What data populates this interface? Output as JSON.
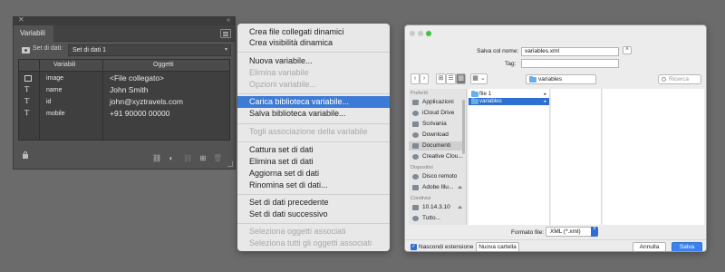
{
  "panel": {
    "close_glyph": "✕",
    "collapse_glyph": "«",
    "tab": "Variabili",
    "dataset_label": "Set di dati:",
    "dataset_value": "Set di dati 1",
    "columns": [
      "Variabili",
      "Oggetti"
    ],
    "rows": [
      {
        "icon": "image-icon",
        "type_glyph": "",
        "name": "image",
        "value": "<File collegato>"
      },
      {
        "icon": "text-icon",
        "type_glyph": "T",
        "name": "name",
        "value": "John Smith"
      },
      {
        "icon": "text-icon",
        "type_glyph": "T",
        "name": "id",
        "value": "john@xyztravels.com"
      },
      {
        "icon": "text-icon",
        "type_glyph": "T",
        "name": "mobile",
        "value": "+91 90000 00000"
      }
    ]
  },
  "menu": {
    "items": [
      {
        "label": "Crea file collegati dinamici",
        "state": "normal"
      },
      {
        "label": "Crea visibilità dinamica",
        "state": "normal"
      },
      {
        "label": "Nuova variabile...",
        "state": "normal"
      },
      {
        "label": "Elimina variabile",
        "state": "disabled"
      },
      {
        "label": "Opzioni variabile...",
        "state": "disabled"
      },
      {
        "label": "Carica biblioteca variabile...",
        "state": "selected"
      },
      {
        "label": "Salva biblioteca variabile...",
        "state": "normal"
      },
      {
        "label": "Togli associazione della variabile",
        "state": "disabled"
      },
      {
        "label": "Cattura set di dati",
        "state": "normal"
      },
      {
        "label": "Elimina set di dati",
        "state": "normal"
      },
      {
        "label": "Aggiorna set di dati",
        "state": "normal"
      },
      {
        "label": "Rinomina set di dati...",
        "state": "normal"
      },
      {
        "label": "Set di dati precedente",
        "state": "normal"
      },
      {
        "label": "Set di dati successivo",
        "state": "normal"
      },
      {
        "label": "Seleziona oggetti associati",
        "state": "disabled"
      },
      {
        "label": "Seleziona tutti gli oggetti associati",
        "state": "disabled"
      }
    ]
  },
  "dialog": {
    "save_as_label": "Salva col nome:",
    "save_as_value": "variables.xml",
    "tags_label": "Tag:",
    "tags_value": "",
    "expand_glyph": "˄",
    "back_glyph": "‹",
    "forward_glyph": "›",
    "view_icon_glyph": "⊞",
    "view_list_glyph": "☰",
    "view_columns_glyph": "▥",
    "view_gallery_glyph": "▦ ⌄",
    "path": "variables",
    "search_placeholder": "Ricerca",
    "sidebar": {
      "favorites_title": "Preferiti",
      "favorites": [
        {
          "label": "Applicazioni",
          "icon": "applications-icon"
        },
        {
          "label": "iCloud Drive",
          "icon": "cloud-icon"
        },
        {
          "label": "Scrivania",
          "icon": "desktop-icon"
        },
        {
          "label": "Download",
          "icon": "download-icon"
        },
        {
          "label": "Documenti",
          "icon": "documents-icon",
          "selected": true
        },
        {
          "label": "Creative Clou...",
          "icon": "creative-cloud-icon"
        }
      ],
      "devices_title": "Dispositivi",
      "devices": [
        {
          "label": "Disco remoto",
          "icon": "disc-icon"
        },
        {
          "label": "Adobe Illu...",
          "icon": "drive-icon",
          "eject": "⏏"
        }
      ],
      "shared_title": "Condivisi",
      "shared": [
        {
          "label": "10.14.3.10",
          "icon": "server-icon",
          "eject": "⏏"
        },
        {
          "label": "Tutto...",
          "icon": "network-icon"
        }
      ]
    },
    "column1": [
      {
        "label": "file 1",
        "selected": false
      },
      {
        "label": "variables",
        "selected": true
      }
    ],
    "arrow_glyph": "▸",
    "format_label": "Formato file:",
    "format_value": "XML (*.xml)",
    "stepper_glyph": "⇕",
    "hide_ext_label": "Nascondi estensione",
    "checkbox_glyph": "✓",
    "new_folder": "Nuova cartella",
    "cancel": "Annulla",
    "save": "Salva"
  }
}
